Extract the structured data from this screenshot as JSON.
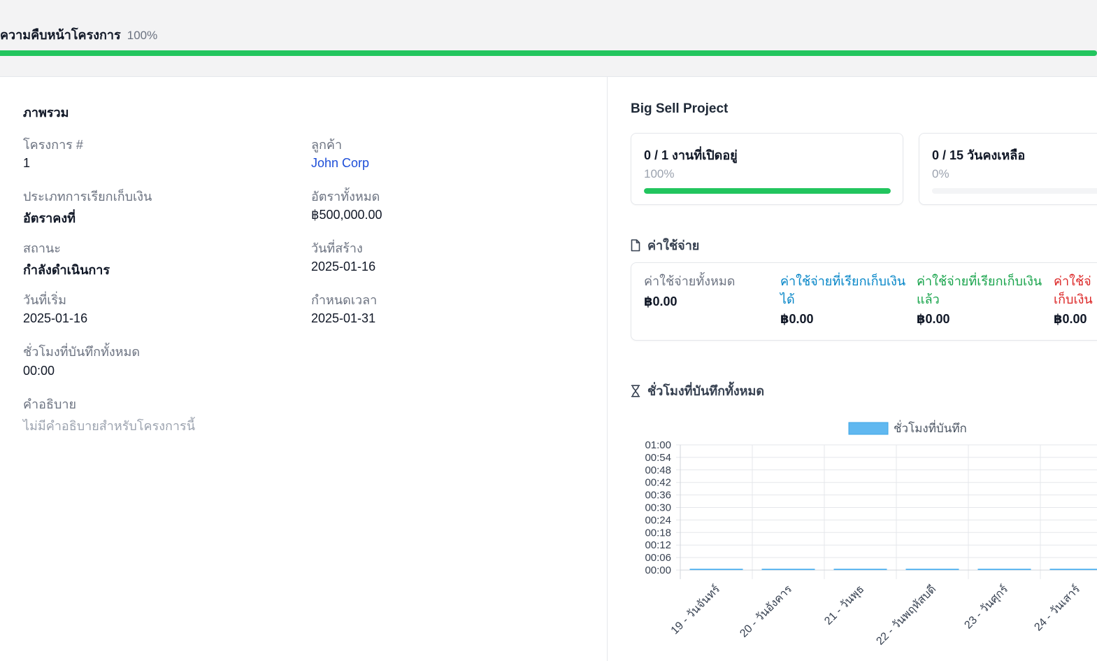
{
  "header": {
    "progress_label": "ความคืบหน้าโครงการ",
    "progress_value": "100%",
    "progress_fraction": 1.0,
    "progress_color": "#22c55e"
  },
  "overview": {
    "title": "ภาพรวม",
    "project_no_label": "โครงการ #",
    "project_no_value": "1",
    "customer_label": "ลูกค้า",
    "customer_value": "John Corp",
    "billing_type_label": "ประเภทการเรียกเก็บเงิน",
    "billing_type_value": "อัตราคงที่",
    "total_rate_label": "อัตราทั้งหมด",
    "total_rate_value": "฿500,000.00",
    "status_label": "สถานะ",
    "status_value": "กำลังดำเนินการ",
    "created_label": "วันที่สร้าง",
    "created_value": "2025-01-16",
    "start_label": "วันที่เริ่ม",
    "start_value": "2025-01-16",
    "deadline_label": "กำหนดเวลา",
    "deadline_value": "2025-01-31",
    "logged_hours_label": "ชั่วโมงที่บันทึกทั้งหมด",
    "logged_hours_value": "00:00",
    "description_label": "คำอธิบาย",
    "description_value": "ไม่มีคำอธิบายสำหรับโครงการนี้"
  },
  "project": {
    "name": "Big Sell Project",
    "tasks_card": {
      "title": "0 / 1 งานที่เปิดอยู่",
      "pct": "100%",
      "fraction": 1.0
    },
    "days_card": {
      "title": "0 / 15 วันคงเหลือ",
      "pct": "0%",
      "fraction": 0.0
    }
  },
  "expenses": {
    "heading": "ค่าใช้จ่าย",
    "items": [
      {
        "line1": "ค่าใช้จ่ายทั้งหมด",
        "line2": "",
        "value": "฿0.00",
        "color": "#6b7280"
      },
      {
        "line1": "ค่าใช้จ่ายที่เรียกเก็บเงิน",
        "line2": "ได้",
        "value": "฿0.00",
        "color": "#0284c7"
      },
      {
        "line1": "ค่าใช้จ่ายที่เรียกเก็บเงิน",
        "line2": "แล้ว",
        "value": "฿0.00",
        "color": "#16a34a"
      },
      {
        "line1": "ค่าใช้จ่",
        "line2": "เก็บเงิน",
        "value": "฿0.00",
        "color": "#dc2626"
      }
    ]
  },
  "hours": {
    "heading": "ชั่วโมงที่บันทึกทั้งหมด"
  },
  "chart_data": {
    "type": "bar",
    "legend": "ชั่วโมงที่บันทึก",
    "legend_placement": "top",
    "series_color": "#60b8f0",
    "categories": [
      "19 - วันจันทร์",
      "20 - วันอังคาร",
      "21 - วันพุธ",
      "22 - วันพฤหัสบดี",
      "23 - วันศุกร์",
      "24 - วันเสาร์"
    ],
    "values": [
      0,
      0,
      0,
      0,
      0,
      0
    ],
    "y_ticks": [
      "00:00",
      "00:06",
      "00:12",
      "00:18",
      "00:24",
      "00:30",
      "00:36",
      "00:42",
      "00:48",
      "00:54",
      "01:00"
    ],
    "ylim": [
      0,
      60
    ],
    "grid": true
  }
}
